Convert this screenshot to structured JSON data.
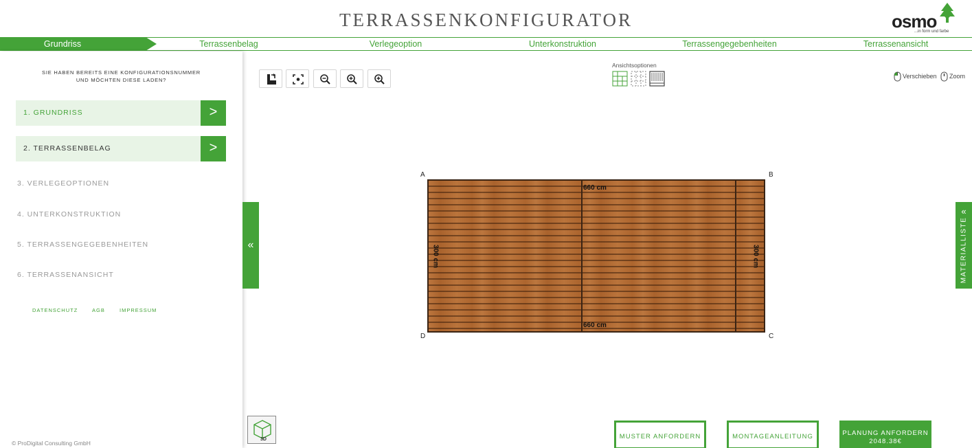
{
  "header": {
    "title": "TERRASSENKONFIGURATOR",
    "logo_word": "osmo",
    "logo_tagline": "...in form und farbe"
  },
  "steps": [
    {
      "label": "Grundriss",
      "active": true
    },
    {
      "label": "Terrassenbelag"
    },
    {
      "label": "Verlegeoption"
    },
    {
      "label": "Unterkonstruktion"
    },
    {
      "label": "Terrassengegebenheiten"
    },
    {
      "label": "Terrassenansicht"
    }
  ],
  "sidebar": {
    "load_note_line1": "SIE HABEN BEREITS EINE KONFIGURATIONSNUMMER",
    "load_note_line2": "UND MÖCHTEN DIESE LADEN?",
    "items": [
      {
        "label": "1. GRUNDRISS",
        "go": ">"
      },
      {
        "label": "2. TERRASSENBELAG",
        "go": ">"
      },
      {
        "label": "3. VERLEGEOPTIONEN"
      },
      {
        "label": "4. UNTERKONSTRUKTION"
      },
      {
        "label": "5. TERRASSENGEGEBENHEITEN"
      },
      {
        "label": "6. TERRASSENANSICHT"
      }
    ],
    "footer_links": [
      "DATENSCHUTZ",
      "AGB",
      "IMPRESSUM"
    ],
    "copyright": "© ProDigital Consulting GmbH",
    "collapse_glyph": "«"
  },
  "toolbar": {
    "icons": [
      "export-icon",
      "fit-view-icon",
      "zoom-out-icon",
      "zoom-in-icon",
      "zoom-reset-icon"
    ]
  },
  "view_options": {
    "label": "Ansichtsoptionen",
    "icons": [
      "grid-view-icon",
      "dotted-view-icon",
      "boards-view-icon"
    ]
  },
  "mouse_hints": {
    "pan": "Verschieben",
    "zoom": "Zoom"
  },
  "plan": {
    "corners": {
      "a": "A",
      "b": "B",
      "c": "C",
      "d": "D"
    },
    "top_dimension": "660 cm",
    "bottom_dimension": "660 cm",
    "left_dimension": "300 cm",
    "right_dimension": "300 cm"
  },
  "material_tab": {
    "label": "MATERIALLISTE",
    "glyph": "«"
  },
  "view3d_label": "3D",
  "actions": {
    "sample": "MUSTER ANFORDERN",
    "manual": "MONTAGEANLEITUNG",
    "request_line1": "PLANUNG ANFORDERN",
    "request_price": "2048.38€"
  },
  "colors": {
    "accent": "#44a338",
    "accent_light": "#e8f4e6",
    "wood": "#b46b32"
  }
}
